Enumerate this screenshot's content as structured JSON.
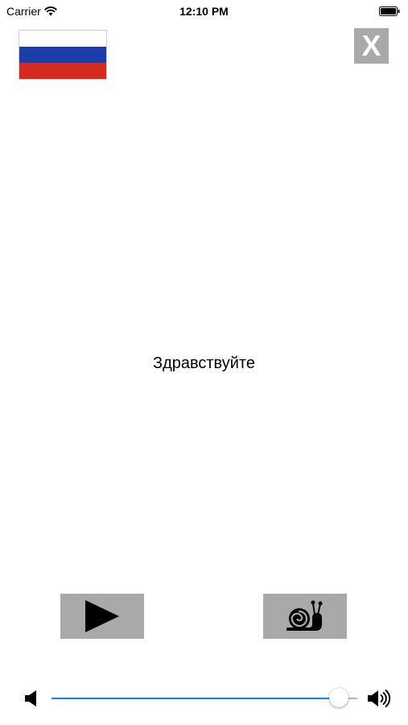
{
  "status_bar": {
    "carrier": "Carrier",
    "time": "12:10 PM",
    "wifi_icon": "wifi-icon",
    "battery_icon": "battery-icon"
  },
  "flag": {
    "icon": "russia-flag-icon",
    "colors": [
      "#ffffff",
      "#1c3ca8",
      "#d52b1e"
    ]
  },
  "close_button": {
    "label": "X",
    "color": "#a9a9a9"
  },
  "phrase": {
    "text": "Здравствуйте"
  },
  "controls": {
    "play_icon": "play-icon",
    "slow_icon": "snail-icon",
    "button_color": "#a9a9a9"
  },
  "volume": {
    "min_icon": "volume-min-icon",
    "max_icon": "volume-max-icon",
    "level": 0.94,
    "accent_color": "#1a82f5"
  }
}
